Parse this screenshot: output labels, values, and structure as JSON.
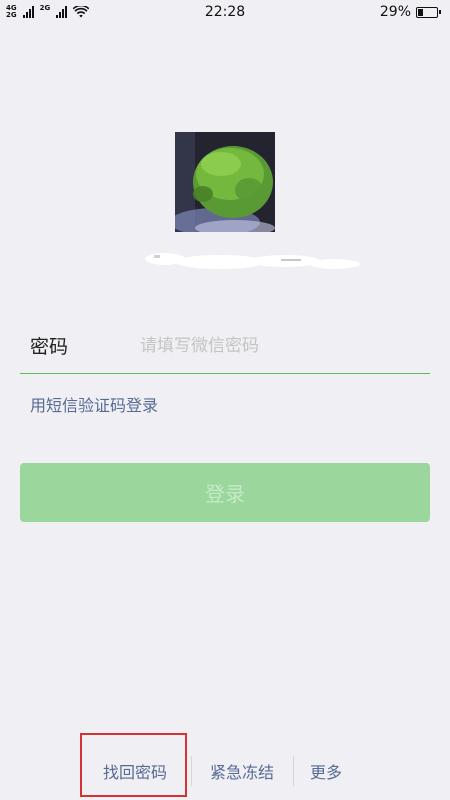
{
  "status_bar": {
    "network_top": "4G",
    "network_bottom": "2G",
    "network_2": "2G",
    "time": "22:28",
    "battery_percent": "29%",
    "battery_level": 0.29
  },
  "login": {
    "password_label": "密码",
    "password_placeholder": "请填写微信密码",
    "sms_login_link": "用短信验证码登录",
    "login_button": "登录"
  },
  "bottom_links": {
    "find_password": "找回密码",
    "emergency_freeze": "紧急冻结",
    "more": "更多"
  },
  "colors": {
    "accent_green": "#5bbe5e",
    "button_green": "#9bd79c",
    "link_blue": "#576b95",
    "highlight_red": "#d23434"
  }
}
